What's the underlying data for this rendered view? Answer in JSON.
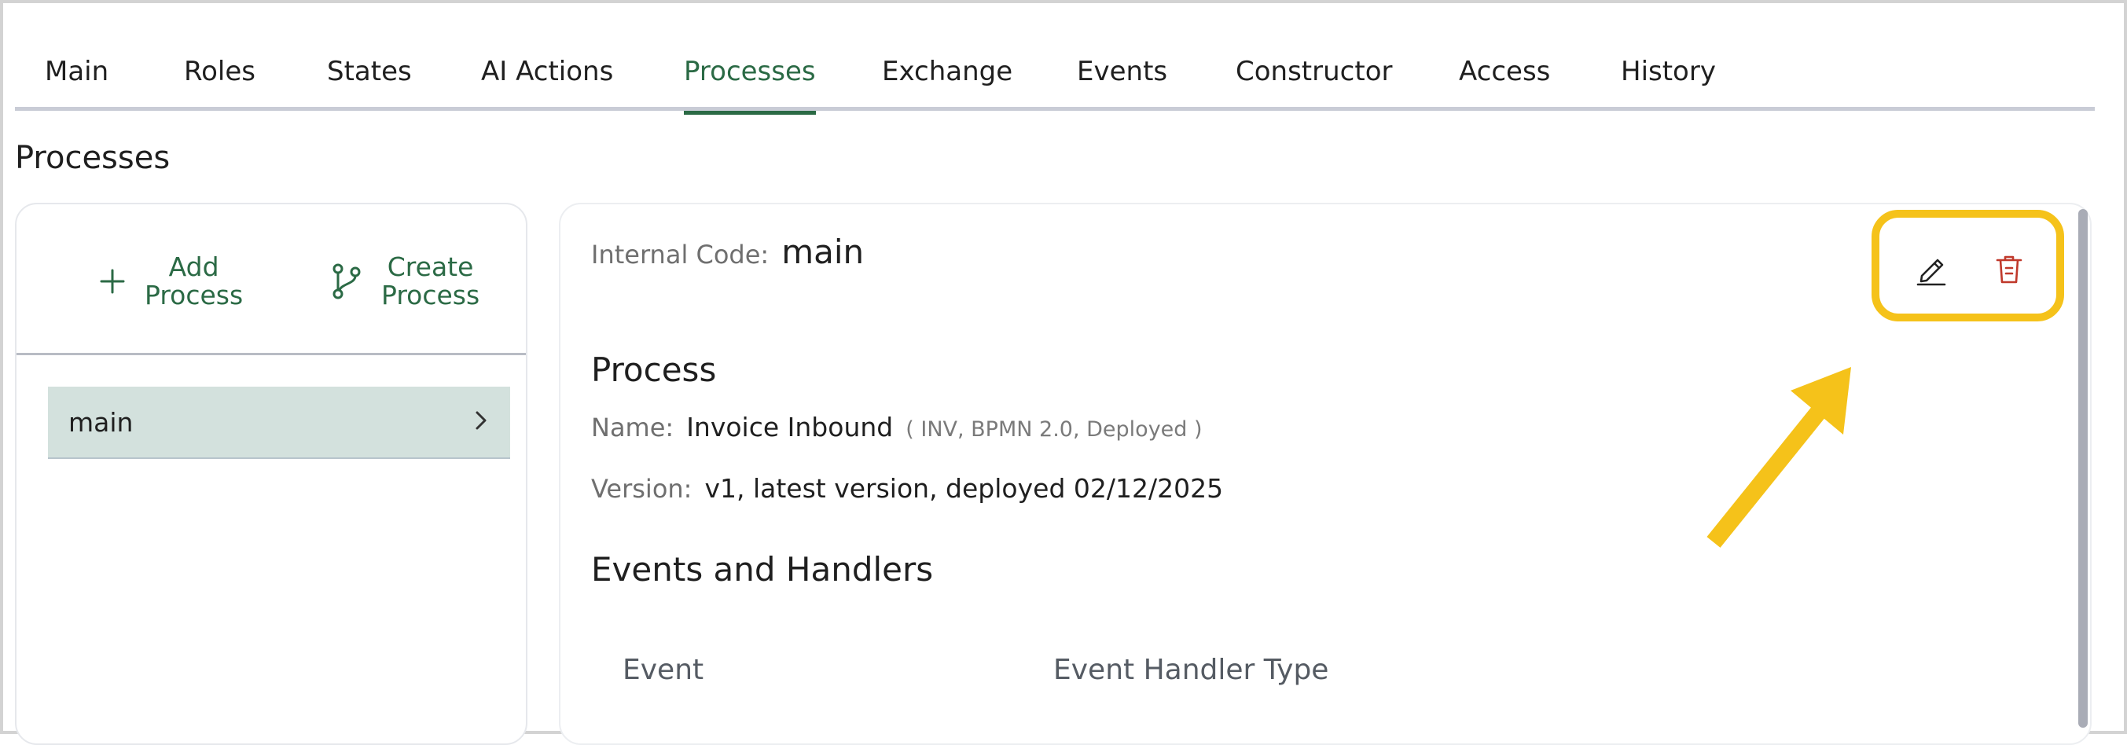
{
  "tabs": [
    {
      "label": "Main"
    },
    {
      "label": "Roles"
    },
    {
      "label": "States"
    },
    {
      "label": "AI Actions"
    },
    {
      "label": "Processes",
      "active": true
    },
    {
      "label": "Exchange"
    },
    {
      "label": "Events"
    },
    {
      "label": "Constructor"
    },
    {
      "label": "Access"
    },
    {
      "label": "History"
    }
  ],
  "page_title": "Processes",
  "left_panel": {
    "add_button": {
      "line1": "Add",
      "line2": "Process",
      "icon": "plus-icon"
    },
    "create_button": {
      "line1": "Create",
      "line2": "Process",
      "icon": "branch-icon"
    },
    "items": [
      {
        "label": "main",
        "icon": "chevron-right-icon"
      }
    ]
  },
  "detail": {
    "internal_code_label": "Internal Code:",
    "internal_code_value": "main",
    "process_heading": "Process",
    "name_label": "Name:",
    "name_value": "Invoice Inbound",
    "name_meta": "( INV, BPMN 2.0, Deployed )",
    "version_label": "Version:",
    "version_value": "v1, latest version, deployed 02/12/2025",
    "events_heading": "Events and Handlers",
    "columns": [
      "Event",
      "Event Handler Type"
    ]
  },
  "actions": {
    "edit_icon": "pencil-icon",
    "delete_icon": "trash-icon"
  },
  "colors": {
    "accent": "#2b6a45",
    "highlight": "#f5c21a",
    "delete": "#c0392b",
    "selected_item_bg": "#d3e1dd"
  }
}
